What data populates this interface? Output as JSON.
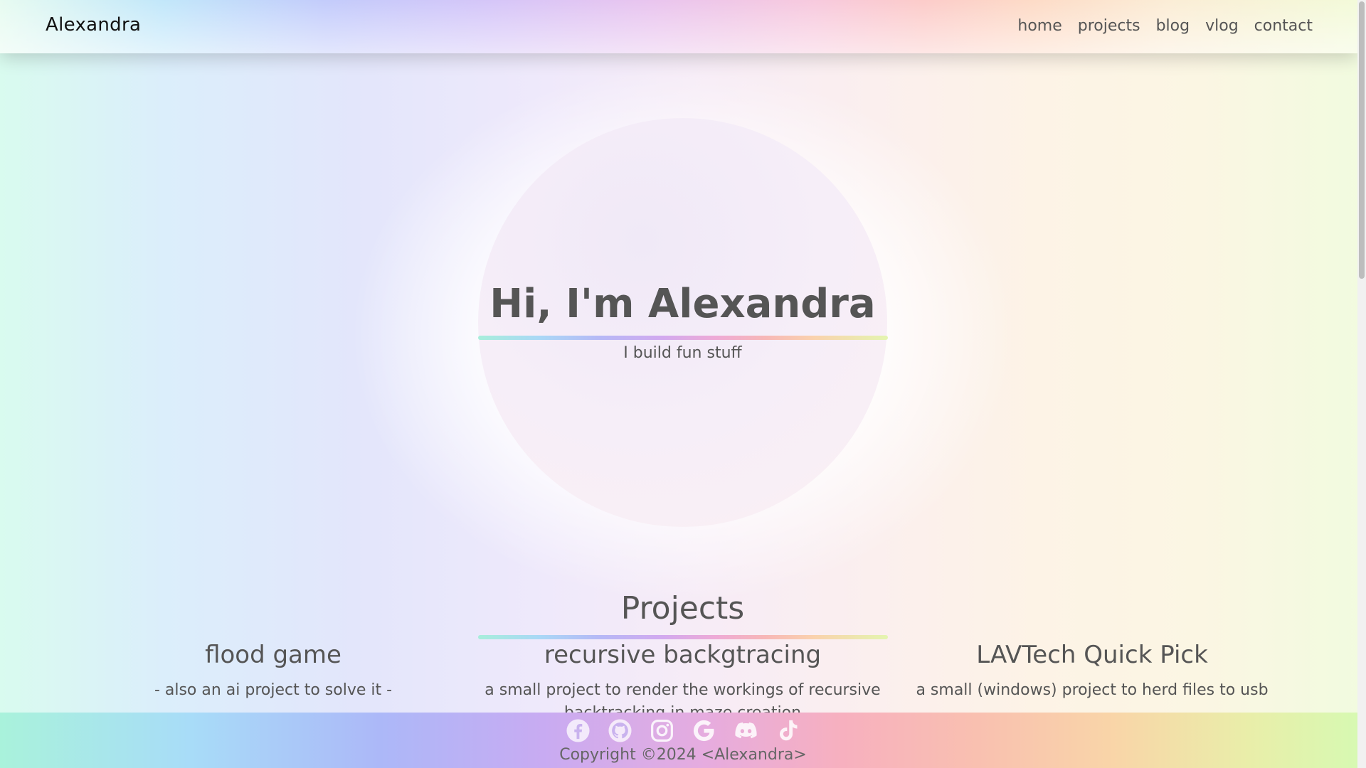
{
  "nav": {
    "brand": "Alexandra",
    "links": [
      "home",
      "projects",
      "blog",
      "vlog",
      "contact"
    ]
  },
  "hero": {
    "title": "Hi, I'm Alexandra",
    "subtitle": "I build fun stuff"
  },
  "projects": {
    "title": "Projects",
    "items": [
      {
        "name": "flood game",
        "desc": "- also an ai project to solve it -"
      },
      {
        "name": "recursive backgtracing",
        "desc": "a small project to render the workings of recursive backtracking in maze creation"
      },
      {
        "name": "LAVTech Quick Pick",
        "desc": "a small (windows) project to herd files to usb"
      }
    ]
  },
  "footer": {
    "social_icons": [
      "facebook-icon",
      "github-icon",
      "instagram-icon",
      "google-icon",
      "discord-icon",
      "tiktok-icon"
    ],
    "copyright": "Copyright ©2024 <Alexandra>"
  }
}
